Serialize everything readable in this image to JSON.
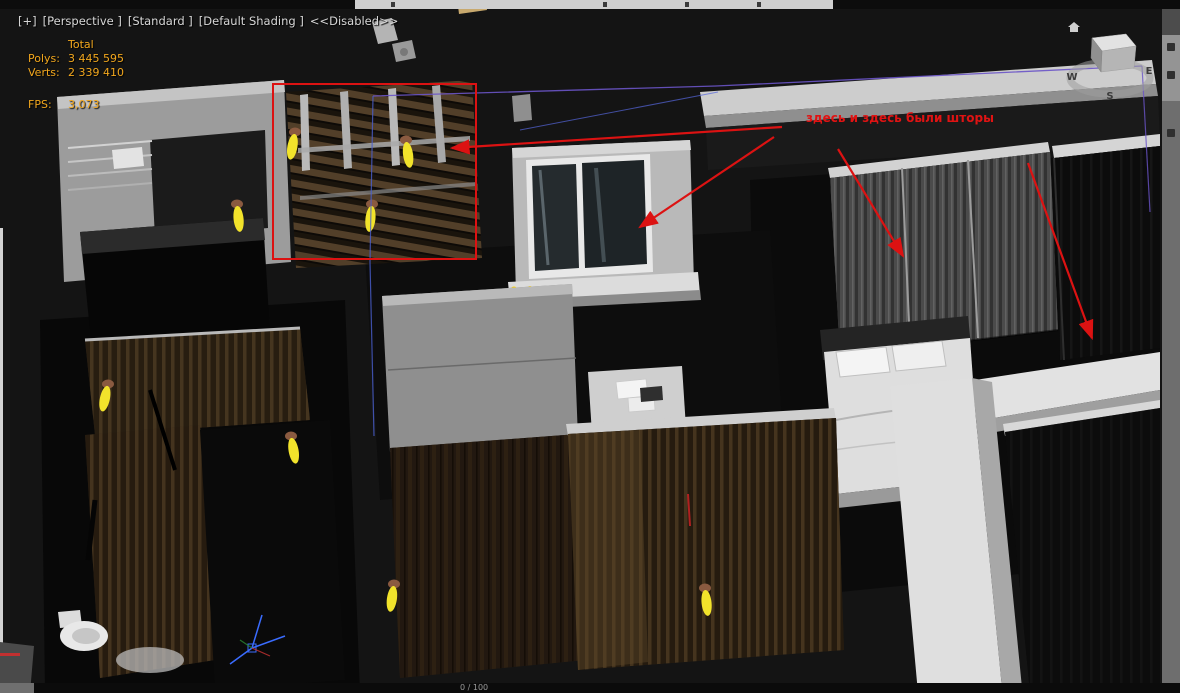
{
  "viewport": {
    "label_segments": [
      {
        "id": "general-menu",
        "text": "[+]"
      },
      {
        "id": "pov-menu",
        "text": "[Perspective ]"
      },
      {
        "id": "render-preset",
        "text": "[Standard ]"
      },
      {
        "id": "shading-menu",
        "text": "[Default Shading ]"
      },
      {
        "id": "disabled-flag",
        "text": "<<Disabled>>"
      }
    ],
    "stats": {
      "total_label": "Total",
      "polys_label": "Polys:",
      "polys_value": "3 445 595",
      "verts_label": "Verts:",
      "verts_value": "2 339 410",
      "fps_label": "FPS:",
      "fps_value": "3,073"
    },
    "viewcube": {
      "west": "W",
      "east": "E",
      "south": "S"
    }
  },
  "annotation": {
    "text": "здесь и здесь были шторы",
    "color_hex": "#e01313"
  },
  "timeline": {
    "frame_indicator": "0 / 100"
  },
  "colors": {
    "stats_orange": "#f2a71d",
    "annotation_red": "#e01313",
    "viewport_bg": "#141414"
  }
}
